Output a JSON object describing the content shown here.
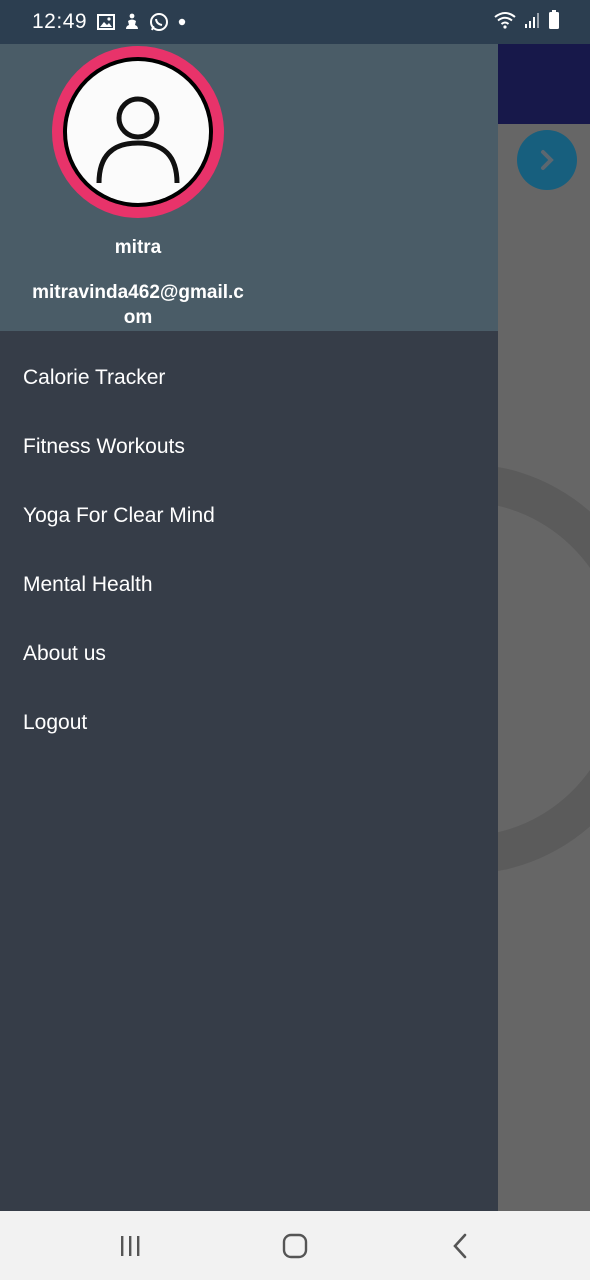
{
  "status_bar": {
    "time": "12:49",
    "left_icons": [
      "image-icon",
      "notification-figure-icon",
      "whatsapp-icon",
      "dot-icon"
    ],
    "right_icons": [
      "wifi-icon",
      "signal-icon",
      "battery-icon"
    ]
  },
  "drawer": {
    "user": {
      "name": "mitra",
      "email": "mitravinda462@gmail.com"
    },
    "menu_items": [
      {
        "label": "Calorie Tracker"
      },
      {
        "label": "Fitness Workouts"
      },
      {
        "label": "Yoga For Clear Mind"
      },
      {
        "label": "Mental Health"
      },
      {
        "label": "About us"
      },
      {
        "label": "Logout"
      }
    ]
  },
  "colors": {
    "status_bar": "#2c3e50",
    "drawer_header": "#4a5c67",
    "drawer_body": "#363d48",
    "avatar_ring": "#e8336a",
    "bg_header": "#17184a",
    "bg_next_button": "#175f7e",
    "nav_bar": "#f2f2f2"
  },
  "nav_bar": {
    "buttons": [
      "recent-apps-icon",
      "home-icon",
      "back-icon"
    ]
  }
}
